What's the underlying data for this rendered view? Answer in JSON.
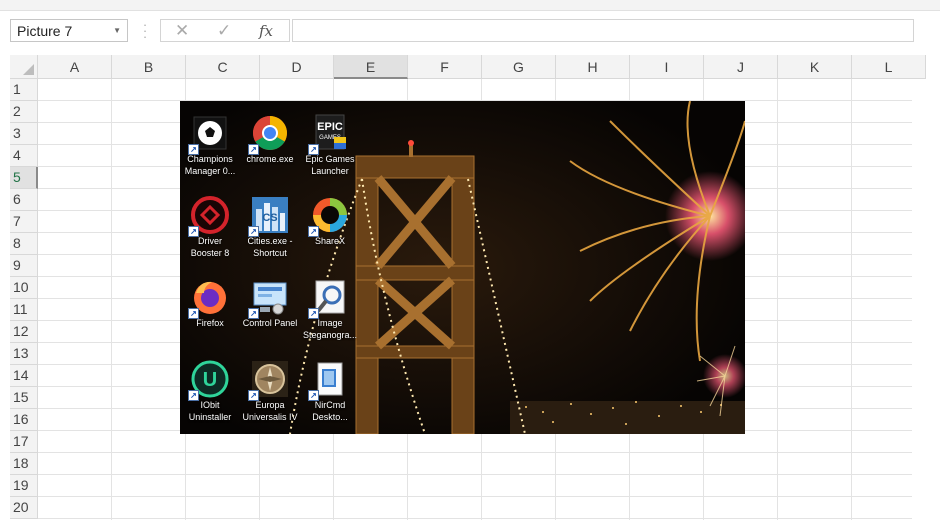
{
  "formula_bar": {
    "name_box": "Picture 7",
    "cancel_symbol": "✕",
    "enter_symbol": "✓",
    "fx_label": "fx",
    "formula": ""
  },
  "columns": [
    "A",
    "B",
    "C",
    "D",
    "E",
    "F",
    "G",
    "H",
    "I",
    "J",
    "K",
    "L"
  ],
  "selected_column": "E",
  "rows": [
    "1",
    "2",
    "3",
    "4",
    "5",
    "6",
    "7",
    "8",
    "9",
    "10",
    "11",
    "12",
    "13",
    "14",
    "15",
    "16",
    "17",
    "18",
    "19",
    "20"
  ],
  "selected_row": "5",
  "picture": {
    "name": "Picture 7",
    "desktop_icons": [
      {
        "label_1": "Champions",
        "label_2": "Manager 0...",
        "icon": "soccer-ball-icon"
      },
      {
        "label_1": "chrome.exe",
        "label_2": "",
        "icon": "chrome-icon"
      },
      {
        "label_1": "Epic Games",
        "label_2": "Launcher",
        "icon": "epic-games-icon"
      },
      {
        "label_1": "Driver",
        "label_2": "Booster 8",
        "icon": "driver-booster-icon"
      },
      {
        "label_1": "Cities.exe -",
        "label_2": "Shortcut",
        "icon": "cities-skylines-icon"
      },
      {
        "label_1": "ShareX",
        "label_2": "",
        "icon": "sharex-icon"
      },
      {
        "label_1": "Firefox",
        "label_2": "",
        "icon": "firefox-icon"
      },
      {
        "label_1": "Control Panel",
        "label_2": "",
        "icon": "control-panel-icon"
      },
      {
        "label_1": "Image",
        "label_2": "Steganogra...",
        "icon": "image-steganography-icon"
      },
      {
        "label_1": "IObit",
        "label_2": "Uninstaller",
        "icon": "iobit-uninstaller-icon"
      },
      {
        "label_1": "Europa",
        "label_2": "Universalis IV",
        "icon": "europa-universalis-icon"
      },
      {
        "label_1": "NirCmd",
        "label_2": "Deskto...",
        "icon": "nircmd-icon"
      }
    ],
    "epic_text": "EPIC",
    "epic_sub": "GAMES",
    "cs_text": "CS",
    "iobit_text": "U"
  },
  "colors": {
    "header_bg": "#f3f3f3",
    "header_selected": "#e1e1e1",
    "gridline": "#e3e3e3",
    "excel_green": "#217346"
  }
}
